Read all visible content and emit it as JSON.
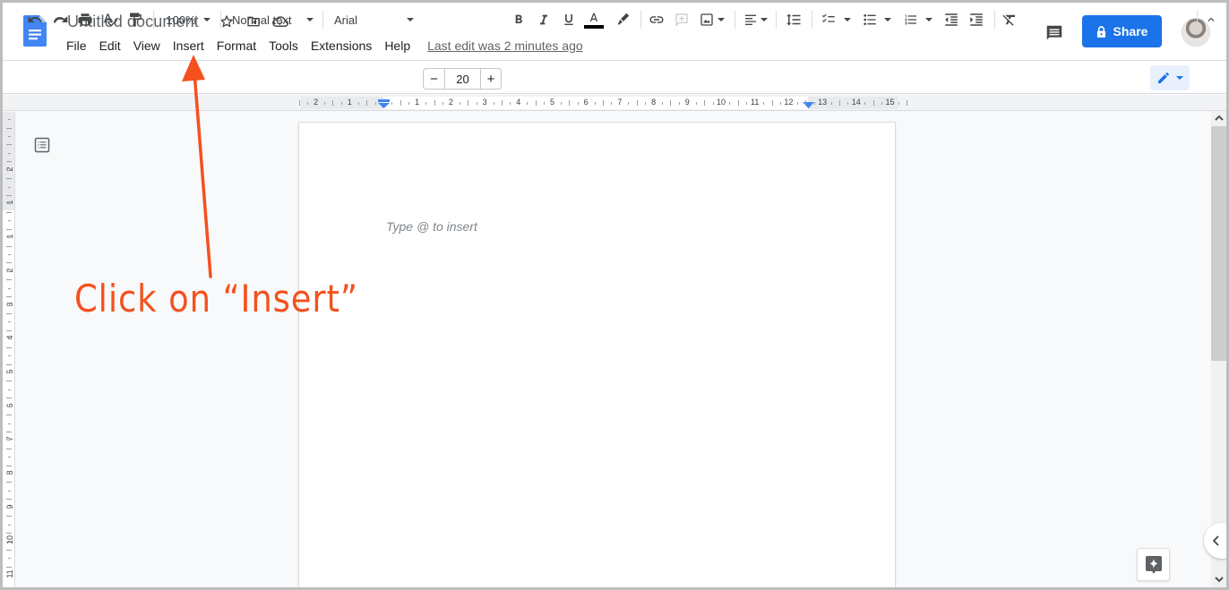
{
  "app": {
    "title": "Untitled document",
    "title_icons": [
      "star-icon",
      "move-to-folder-icon",
      "cloud-saved-icon"
    ],
    "menu": [
      "File",
      "Edit",
      "View",
      "Insert",
      "Format",
      "Tools",
      "Extensions",
      "Help"
    ],
    "last_edit": "Last edit was 2 minutes ago",
    "share_label": "Share",
    "colors": {
      "accent": "#1a73e8",
      "annotation": "#f4511e"
    }
  },
  "toolbar": {
    "zoom": "100%",
    "style": "Normal text",
    "font": "Arial",
    "font_size": "20",
    "minus": "−",
    "plus": "+"
  },
  "ruler": {
    "horizontal_labels": [
      "2",
      "1",
      "1",
      "2",
      "3",
      "4",
      "5",
      "6",
      "7",
      "8",
      "9",
      "10",
      "11",
      "12",
      "13",
      "14",
      "15"
    ],
    "vertical_labels": [
      "2",
      "1",
      "1",
      "2",
      "3",
      "4",
      "5",
      "6",
      "7",
      "8",
      "9",
      "10",
      "11"
    ]
  },
  "document": {
    "placeholder": "Type @ to insert"
  },
  "annotation": {
    "text": "Click on “Insert”"
  }
}
